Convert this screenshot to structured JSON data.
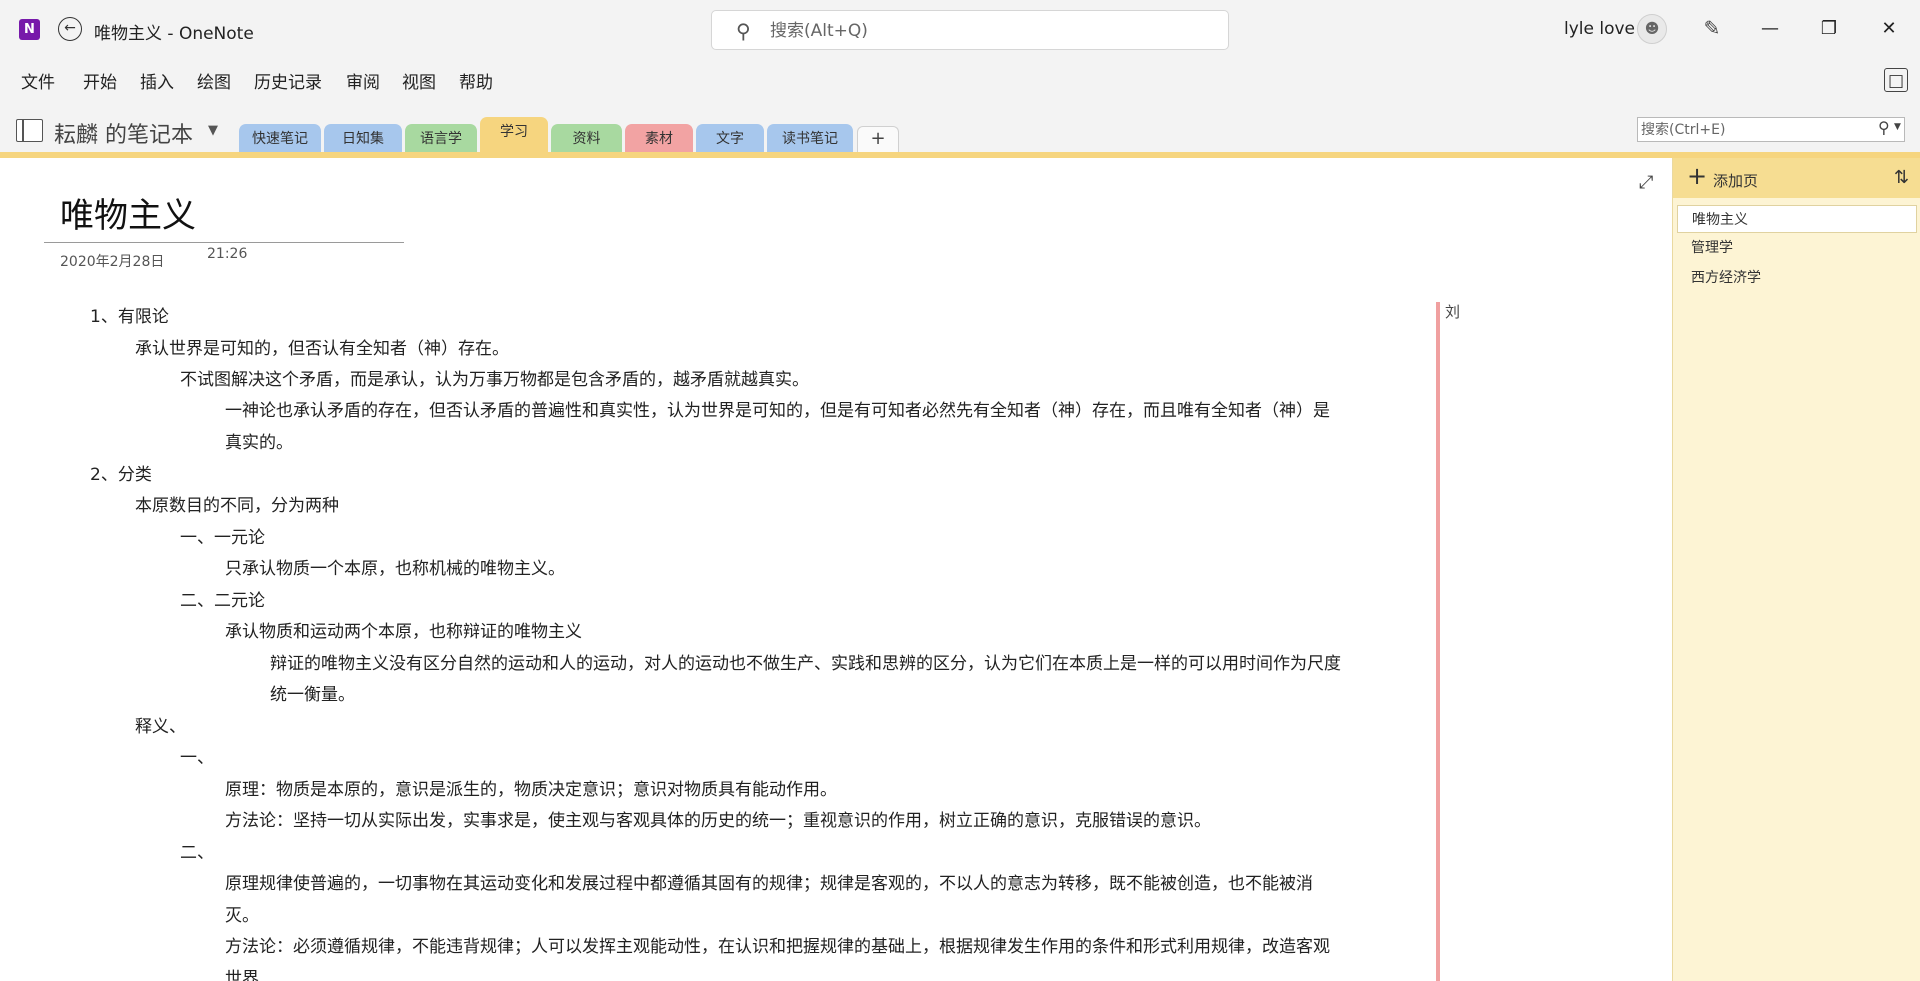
{
  "titlebar": {
    "app_icon_label": "N",
    "window_title": "唯物主义  -  OneNote",
    "search_placeholder": "搜索(Alt+Q)",
    "user_name": "lyle love",
    "icons": {
      "app": "onenote-logo-icon",
      "back": "back-arrow-icon",
      "search": "search-icon",
      "avatar": "avatar",
      "pen": "pen-icon",
      "minimize": "minimize-icon",
      "restore": "restore-icon",
      "close": "close-icon"
    }
  },
  "menu": {
    "items": [
      "文件",
      "开始",
      "插入",
      "绘图",
      "历史记录",
      "审阅",
      "视图",
      "帮助"
    ]
  },
  "notebook": {
    "name": "耘麟 的笔记本",
    "sections": [
      {
        "label": "快速笔记",
        "color": "#a7c7ed"
      },
      {
        "label": "日知集",
        "color": "#a7c7ed"
      },
      {
        "label": "语言学",
        "color": "#a8d9a0"
      },
      {
        "label": "学习",
        "color": "#f6d57f",
        "active": true
      },
      {
        "label": "资料",
        "color": "#a8d9a0"
      },
      {
        "label": "素材",
        "color": "#f2a3a3"
      },
      {
        "label": "文字",
        "color": "#a7c7ed"
      },
      {
        "label": "读书笔记",
        "color": "#a7c7ed"
      }
    ],
    "add_section_label": "+",
    "page_search_placeholder": "搜索(Ctrl+E)"
  },
  "page": {
    "title": "唯物主义",
    "date": "2020年2月28日",
    "time": "21:26",
    "margin_author": "刘",
    "lines": [
      "1、有限论",
      "承认世界是可知的，但否认有全知者（神）存在。",
      "不试图解决这个矛盾，而是承认，认为万事万物都是包含矛盾的，越矛盾就越真实。",
      "一神论也承认矛盾的存在，但否认矛盾的普遍性和真实性，认为世界是可知的，但是有可知者必然先有全知者（神）存在，而且唯有全知者（神）是",
      "真实的。",
      "2、分类",
      "本原数目的不同，分为两种",
      "一、一元论",
      "只承认物质一个本原，也称机械的唯物主义。",
      "二、二元论",
      "承认物质和运动两个本原，也称辩证的唯物主义",
      "辩证的唯物主义没有区分自然的运动和人的运动，对人的运动也不做生产、实践和思辨的区分，认为它们在本质上是一样的可以用时间作为尺度",
      "统一衡量。",
      "释义、",
      "一、",
      "原理：物质是本原的，意识是派生的，物质决定意识；意识对物质具有能动作用。",
      "方法论：坚持一切从实际出发，实事求是，使主观与客观具体的历史的统一；重视意识的作用，树立正确的意识，克服错误的意识。",
      "二、",
      "原理规律使普遍的，一切事物在其运动变化和发展过程中都遵循其固有的规律；规律是客观的，不以人的意志为转移，既不能被创造，也不能被消",
      "灭。",
      "方法论：必须遵循规律，不能违背规律；人可以发挥主观能动性，在认识和把握规律的基础上，根据规律发生作用的条件和形式利用规律，改造客观",
      "世界"
    ]
  },
  "pagelist": {
    "add_page_label": "添加页",
    "pages": [
      "唯物主义",
      "管理学",
      "西方经济学"
    ]
  }
}
